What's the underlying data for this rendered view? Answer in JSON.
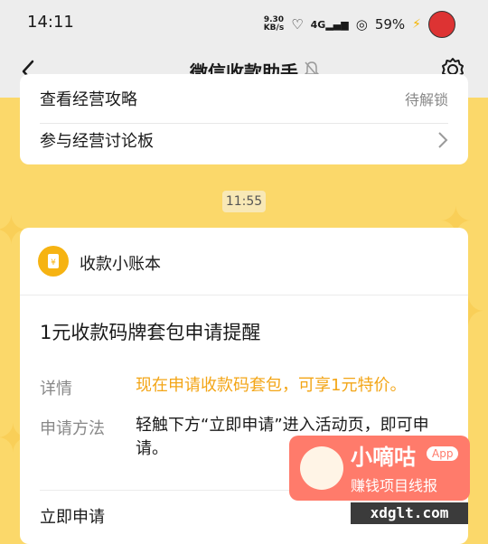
{
  "status_bar": {
    "time": "14:11",
    "speed_value": "9.30",
    "speed_unit": "KB/s",
    "network": "4G",
    "battery": "59%"
  },
  "nav": {
    "title": "微信收款助手"
  },
  "menu": {
    "partial_left": "查看经营攻略",
    "partial_right": "待解锁",
    "board_label": "参与经营讨论板"
  },
  "message_time": "11:55",
  "ledger_card": {
    "header_title": "收款小账本",
    "notice_title": "1元收款码牌套包申请提醒",
    "detail_label": "详情",
    "detail_value": "现在申请收款码套包，可享1元特价。",
    "method_label": "申请方法",
    "method_value": "轻触下方“立即申请”进入活动页，即可申请。",
    "action_label": "立即申请"
  },
  "watermark": {
    "name": "小嘀咕",
    "badge": "App",
    "tagline": "赚钱项目线报",
    "url": "xdglt.com"
  },
  "colors": {
    "accent": "#f3a516",
    "background": "#fbd86a"
  }
}
